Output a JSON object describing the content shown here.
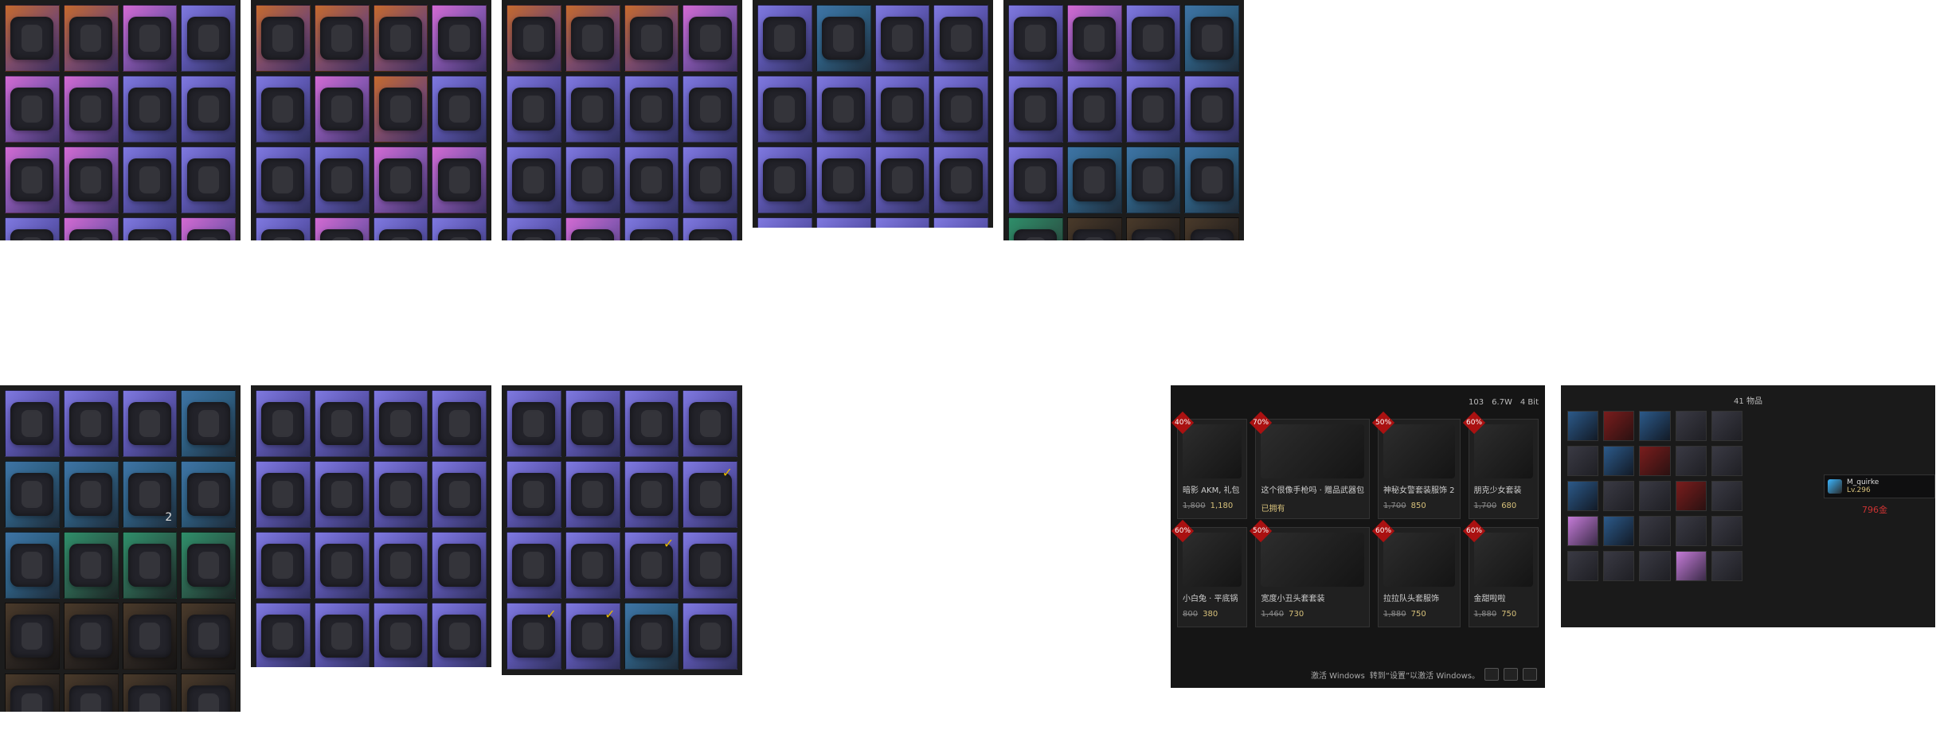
{
  "colors": {
    "page_bg": "#ffffff",
    "panel_bg": "#1c1c1c",
    "accent_gold": "#e6b800",
    "discount_red": "#aa1111",
    "price_gold": "#d6c07a"
  },
  "inventory_panels": [
    {
      "id": "outfits_1",
      "rows": 5,
      "tiles": [
        {
          "bg": "orange",
          "icon": "jacket-icon"
        },
        {
          "bg": "orange",
          "icon": "scarf-icon"
        },
        {
          "bg": "pink",
          "icon": "bag-icon"
        },
        {
          "bg": "purple",
          "icon": "suit-icon"
        },
        {
          "bg": "pink",
          "icon": "jacket-icon"
        },
        {
          "bg": "pink",
          "icon": "hoodie-icon"
        },
        {
          "bg": "purple",
          "icon": "vest-icon"
        },
        {
          "bg": "purple",
          "icon": "coat-icon"
        },
        {
          "bg": "pink",
          "icon": "jacket-icon"
        },
        {
          "bg": "pink",
          "icon": "top-icon"
        },
        {
          "bg": "purple",
          "icon": "dress-icon"
        },
        {
          "bg": "purple",
          "icon": "dress-icon"
        },
        {
          "bg": "purple",
          "icon": "armor-icon"
        },
        {
          "bg": "pink",
          "icon": "shirt-icon"
        },
        {
          "bg": "purple",
          "icon": "dress-icon"
        },
        {
          "bg": "pink",
          "icon": "costume-icon"
        },
        {
          "bg": "purple",
          "icon": "costume-icon"
        },
        {
          "bg": "purple",
          "icon": "jacket-icon"
        },
        {
          "bg": "purple",
          "icon": "jacket-icon"
        },
        {
          "bg": "purple",
          "icon": "coat-icon"
        }
      ]
    },
    {
      "id": "outfits_2",
      "rows": 5,
      "tiles": [
        {
          "bg": "orange",
          "icon": "dress-icon"
        },
        {
          "bg": "orange",
          "icon": "dress-icon"
        },
        {
          "bg": "orange",
          "icon": "coat-icon"
        },
        {
          "bg": "pink",
          "icon": "bag-icon"
        },
        {
          "bg": "purple",
          "icon": "jacket-icon"
        },
        {
          "bg": "pink",
          "icon": "top-icon"
        },
        {
          "bg": "orange",
          "icon": "armor-icon"
        },
        {
          "bg": "purple",
          "icon": "jacket-icon"
        },
        {
          "bg": "purple",
          "icon": "top-icon"
        },
        {
          "bg": "purple",
          "icon": "suit-icon"
        },
        {
          "bg": "pink",
          "icon": "top-icon"
        },
        {
          "bg": "pink",
          "icon": "jacket-icon"
        },
        {
          "bg": "purple",
          "icon": "jacket-icon"
        },
        {
          "bg": "pink",
          "icon": "top-icon"
        },
        {
          "bg": "purple",
          "icon": "shirt-icon"
        },
        {
          "bg": "purple",
          "icon": "vest-icon"
        },
        {
          "bg": "pink",
          "icon": "dress-icon"
        },
        {
          "bg": "purple",
          "icon": "accessory-icon"
        },
        {
          "bg": "purple",
          "icon": "shirt-icon"
        },
        {
          "bg": "purple",
          "icon": "dress-icon"
        }
      ]
    },
    {
      "id": "outfits_3",
      "rows": 5,
      "tiles": [
        {
          "bg": "orange",
          "icon": "dress-icon"
        },
        {
          "bg": "orange",
          "icon": "dress-icon"
        },
        {
          "bg": "orange",
          "icon": "coat-icon"
        },
        {
          "bg": "pink",
          "icon": "dress-icon"
        },
        {
          "bg": "purple",
          "icon": "suit-icon"
        },
        {
          "bg": "purple",
          "icon": "pants-icon"
        },
        {
          "bg": "purple",
          "icon": "shorts-icon"
        },
        {
          "bg": "purple",
          "icon": "skirt-icon"
        },
        {
          "bg": "purple",
          "icon": "pants-icon"
        },
        {
          "bg": "purple",
          "icon": "shorts-icon"
        },
        {
          "bg": "purple",
          "icon": "dress-icon"
        },
        {
          "bg": "purple",
          "icon": "dress-icon"
        },
        {
          "bg": "purple",
          "icon": "suit-icon"
        },
        {
          "bg": "pink",
          "icon": "bodysuit-icon"
        },
        {
          "bg": "purple",
          "icon": "bodysuit-icon"
        },
        {
          "bg": "purple",
          "icon": "dress-icon"
        },
        {
          "bg": "purple",
          "icon": "stockings-icon"
        },
        {
          "bg": "purple",
          "icon": "bodysuit-icon"
        },
        {
          "bg": "purple",
          "icon": "dress-icon"
        },
        {
          "bg": "pink",
          "icon": "costume-icon"
        }
      ]
    },
    {
      "id": "headgear_masks",
      "rows": 5,
      "tiles": [
        {
          "bg": "purple",
          "icon": "bunny-mask-icon"
        },
        {
          "bg": "blue",
          "icon": "wolf-mask-icon"
        },
        {
          "bg": "purple",
          "icon": "cap-icon"
        },
        {
          "bg": "purple",
          "icon": "beanie-icon"
        },
        {
          "bg": "purple",
          "icon": "cowboy-hat-icon"
        },
        {
          "bg": "purple",
          "icon": "bald-head-icon"
        },
        {
          "bg": "purple",
          "icon": "gas-mask-icon"
        },
        {
          "bg": "purple",
          "icon": "nose-icon"
        },
        {
          "bg": "purple",
          "icon": "bandana-icon"
        },
        {
          "bg": "purple",
          "icon": "mask-icon"
        },
        {
          "bg": "purple",
          "icon": "balaclava-icon"
        },
        {
          "bg": "purple",
          "icon": "goggles-icon"
        },
        {
          "bg": "purple",
          "icon": "sunglasses-icon"
        },
        {
          "bg": "purple",
          "icon": "eye-mask-icon"
        },
        {
          "bg": "purple",
          "icon": "sunglasses-icon"
        },
        {
          "bg": "purple",
          "icon": "glasses-icon"
        },
        {
          "bg": "purple",
          "icon": "visor-icon"
        },
        {
          "bg": "purple",
          "icon": "glasses-icon"
        },
        {
          "bg": "purple",
          "icon": "heart-glasses-icon"
        },
        {
          "bg": "purple",
          "icon": "round-glasses-icon"
        }
      ]
    },
    {
      "id": "gloves",
      "rows": 5,
      "tiles": [
        {
          "bg": "purple",
          "icon": "glove-icon"
        },
        {
          "bg": "pink",
          "icon": "glove-icon"
        },
        {
          "bg": "purple",
          "icon": "bracer-icon"
        },
        {
          "bg": "blue",
          "icon": "nails-icon"
        },
        {
          "bg": "purple",
          "icon": "nails-icon"
        },
        {
          "bg": "purple",
          "icon": "glove-icon"
        },
        {
          "bg": "purple",
          "icon": "glove-icon"
        },
        {
          "bg": "purple",
          "icon": "glove-icon"
        },
        {
          "bg": "purple",
          "icon": "coat-icon"
        },
        {
          "bg": "blue",
          "icon": "glove-icon"
        },
        {
          "bg": "blue",
          "icon": "glove-icon"
        },
        {
          "bg": "blue",
          "icon": "glove-icon"
        },
        {
          "bg": "green",
          "icon": "glove-icon"
        },
        {
          "bg": "dark",
          "icon": "glove-icon"
        },
        {
          "bg": "dark",
          "icon": "glove-icon"
        },
        {
          "bg": "dark",
          "icon": "glove-icon"
        },
        {
          "bg": "dark",
          "icon": "glove-icon"
        },
        {
          "bg": "dark",
          "icon": "glove-icon"
        },
        {
          "bg": "dark",
          "icon": "glove-icon"
        },
        {
          "bg": "dark",
          "icon": "glove-icon"
        }
      ]
    },
    {
      "id": "accessories",
      "rows": 5,
      "tiles": [
        {
          "bg": "purple",
          "icon": "glasses-icon"
        },
        {
          "bg": "purple",
          "icon": "glasses-icon"
        },
        {
          "bg": "purple",
          "icon": "glasses-icon"
        },
        {
          "bg": "blue",
          "icon": "helmet-icon"
        },
        {
          "bg": "blue",
          "icon": "scarf-icon"
        },
        {
          "bg": "blue",
          "icon": "mask-icon"
        },
        {
          "bg": "blue",
          "icon": "sunglasses-icon",
          "badge": "2"
        },
        {
          "bg": "blue",
          "icon": "sunglasses-icon"
        },
        {
          "bg": "blue",
          "icon": "cat-mask-icon"
        },
        {
          "bg": "green",
          "icon": "sunglasses-icon"
        },
        {
          "bg": "green",
          "icon": "sunglasses-icon"
        },
        {
          "bg": "green",
          "icon": "sunglasses-icon"
        },
        {
          "bg": "dark",
          "icon": "bucket-hat-icon"
        },
        {
          "bg": "dark",
          "icon": "sun-hat-icon"
        },
        {
          "bg": "dark",
          "icon": "cap-icon"
        },
        {
          "bg": "dark",
          "icon": "headband-icon"
        },
        {
          "bg": "dark",
          "icon": "ice-cream-icon"
        },
        {
          "bg": "dark",
          "icon": "cap-icon"
        },
        {
          "bg": "dark",
          "icon": "hat-icon"
        },
        {
          "bg": "dark",
          "icon": "bucket-hat-icon"
        }
      ]
    },
    {
      "id": "helmets",
      "rows": 4,
      "tiles": [
        {
          "bg": "purple",
          "icon": "helmet-icon"
        },
        {
          "bg": "purple",
          "icon": "helmet-icon"
        },
        {
          "bg": "purple",
          "icon": "helmet-icon"
        },
        {
          "bg": "purple",
          "icon": "helmet-icon"
        },
        {
          "bg": "purple",
          "icon": "helmet-icon"
        },
        {
          "bg": "purple",
          "icon": "helmet-icon"
        },
        {
          "bg": "purple",
          "icon": "helmet-icon"
        },
        {
          "bg": "purple",
          "icon": "helmet-icon"
        },
        {
          "bg": "purple",
          "icon": "helmet-icon"
        },
        {
          "bg": "purple",
          "icon": "helmet-icon"
        },
        {
          "bg": "purple",
          "icon": "helmet-icon"
        },
        {
          "bg": "purple",
          "icon": "helmet-icon"
        },
        {
          "bg": "purple",
          "icon": "helmet-icon"
        },
        {
          "bg": "purple",
          "icon": "helmet-icon"
        },
        {
          "bg": "purple",
          "icon": "helmet-icon"
        },
        {
          "bg": "purple",
          "icon": "helmet-icon"
        }
      ]
    },
    {
      "id": "backpacks_vests",
      "rows": 4,
      "tiles": [
        {
          "bg": "purple",
          "icon": "backpack-icon"
        },
        {
          "bg": "purple",
          "icon": "backpack-icon"
        },
        {
          "bg": "purple",
          "icon": "backpack-icon"
        },
        {
          "bg": "purple",
          "icon": "backpack-icon"
        },
        {
          "bg": "purple",
          "icon": "backpack-icon"
        },
        {
          "bg": "purple",
          "icon": "backpack-icon"
        },
        {
          "bg": "purple",
          "icon": "backpack-icon"
        },
        {
          "bg": "purple",
          "icon": "backpack-icon",
          "check": true
        },
        {
          "bg": "purple",
          "icon": "backpack-icon"
        },
        {
          "bg": "purple",
          "icon": "backpack-icon"
        },
        {
          "bg": "purple",
          "icon": "backpack-icon",
          "check": true
        },
        {
          "bg": "purple",
          "icon": "vest-icon"
        },
        {
          "bg": "purple",
          "icon": "vest-icon",
          "check": true
        },
        {
          "bg": "purple",
          "icon": "vest-icon",
          "check": true
        },
        {
          "bg": "blue",
          "icon": "helmet-icon"
        },
        {
          "bg": "purple",
          "icon": "backpack-icon"
        }
      ]
    }
  ],
  "store": {
    "top_info": [
      "103",
      "6.7W",
      "4 Bit"
    ],
    "footer": [
      "激活 Windows",
      "转到“设置”以激活 Windows。"
    ],
    "items": [
      {
        "discount": "40%",
        "name": "暗影 AKM, 礼包",
        "old_price": "1,800",
        "price": "1,180",
        "icon": "rifle-icon"
      },
      {
        "discount": "70%",
        "name": "这个很像手枪吗 · 赠品武器包",
        "old_price": "",
        "price": "已拥有",
        "icon": "rifle-icon"
      },
      {
        "discount": "50%",
        "name": "神秘女警套装服饰 2",
        "old_price": "1,700",
        "price": "850",
        "icon": "character-icon"
      },
      {
        "discount": "60%",
        "name": "朋克少女套装",
        "old_price": "1,700",
        "price": "680",
        "icon": "character-icon"
      },
      {
        "discount": "60%",
        "name": "小白兔 · 平底锅",
        "old_price": "800",
        "price": "380",
        "icon": "pan-icon"
      },
      {
        "discount": "50%",
        "name": "宽度小丑头套套装",
        "old_price": "1,460",
        "price": "730",
        "icon": "mask-icon"
      },
      {
        "discount": "60%",
        "name": "拉拉队头套服饰",
        "old_price": "1,880",
        "price": "750",
        "icon": "character-icon"
      },
      {
        "discount": "60%",
        "name": "金甜啦啦",
        "old_price": "1,880",
        "price": "750",
        "icon": "character-icon"
      }
    ]
  },
  "profile": {
    "title": "41 物品",
    "name": "M_quirke",
    "level": "Lv.296",
    "coins": "796金"
  }
}
